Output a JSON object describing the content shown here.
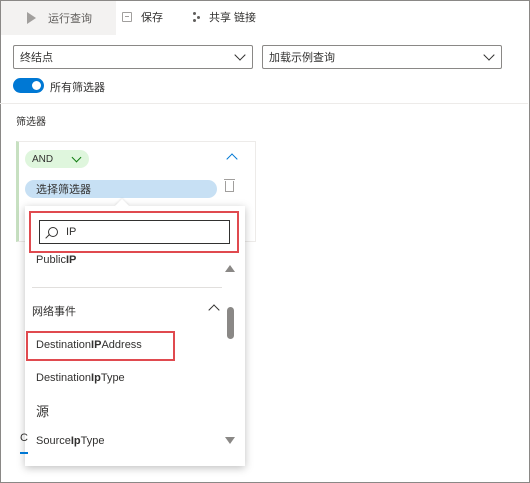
{
  "toolbar": {
    "run_label": "运行查询",
    "save_label": "保存",
    "share_label": "共享 链接"
  },
  "filters_bar": {
    "left_dropdown": "终结点",
    "right_dropdown": "加载示例查询",
    "toggle_label": "所有筛选器",
    "toggle_on": true
  },
  "section_label": "筛选器",
  "filter_card": {
    "operator": "AND",
    "select_filter_label": "选择筛选器"
  },
  "search": {
    "value": "IP"
  },
  "list": {
    "partial_item": {
      "pre": "Public",
      "match": "IP",
      "post": ""
    },
    "group_label": "网络事件",
    "items": [
      {
        "pre": "Destination",
        "match": "IP",
        "post": "Address"
      },
      {
        "pre": "Destination",
        "match": "Ip",
        "post": "Type"
      }
    ],
    "source_label": "源",
    "source_item": {
      "pre": "Source",
      "match": "Ip",
      "post": "Type"
    }
  },
  "tab_stub": "C",
  "colors": {
    "accent": "#0078d4",
    "highlight": "#e04a4f",
    "and_pill_bg": "#dff6dd",
    "select_pill_bg": "#c7e0f4"
  },
  "icons": [
    "play-icon",
    "save-icon",
    "share-icon",
    "chevron-down-icon",
    "chevron-up-icon",
    "trash-icon",
    "search-icon",
    "scroll-up-icon",
    "scroll-down-icon"
  ]
}
